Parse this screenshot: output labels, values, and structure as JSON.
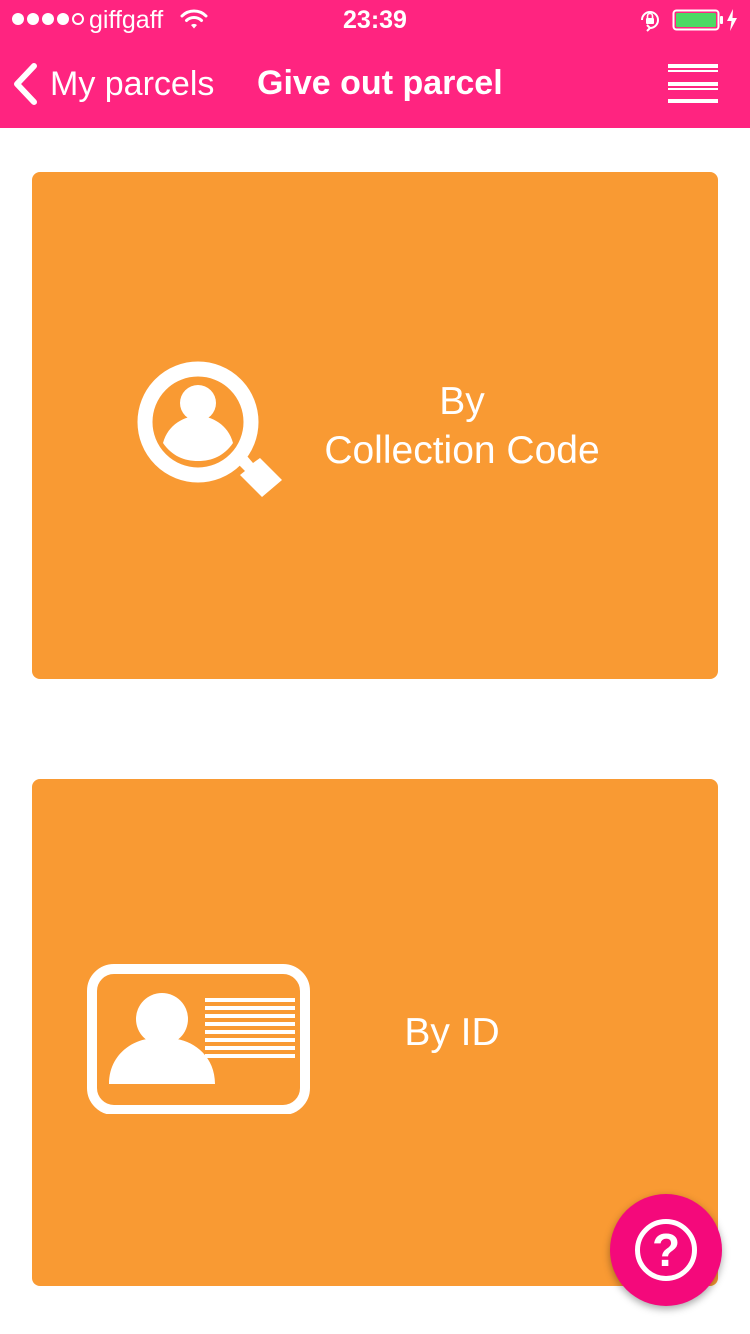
{
  "status_bar": {
    "carrier": "giffgaff",
    "time": "23:39",
    "signal_bars_filled": 4,
    "signal_bars_total": 5,
    "icons": [
      "wifi-icon",
      "orientation-lock-icon",
      "battery-icon",
      "charging-icon"
    ]
  },
  "nav": {
    "back_label": "My parcels",
    "title": "Give out parcel",
    "menu_icon": "hamburger-menu-icon"
  },
  "options": [
    {
      "line1": "By",
      "line2": "Collection Code",
      "icon": "search-person-icon"
    },
    {
      "label": "By ID",
      "icon": "id-card-icon"
    }
  ],
  "help": {
    "glyph": "?",
    "icon": "help-icon"
  },
  "colors": {
    "header": "#ff2480",
    "card": "#f99a33",
    "help_button": "#f4097b",
    "battery_fill": "#4cd964"
  }
}
